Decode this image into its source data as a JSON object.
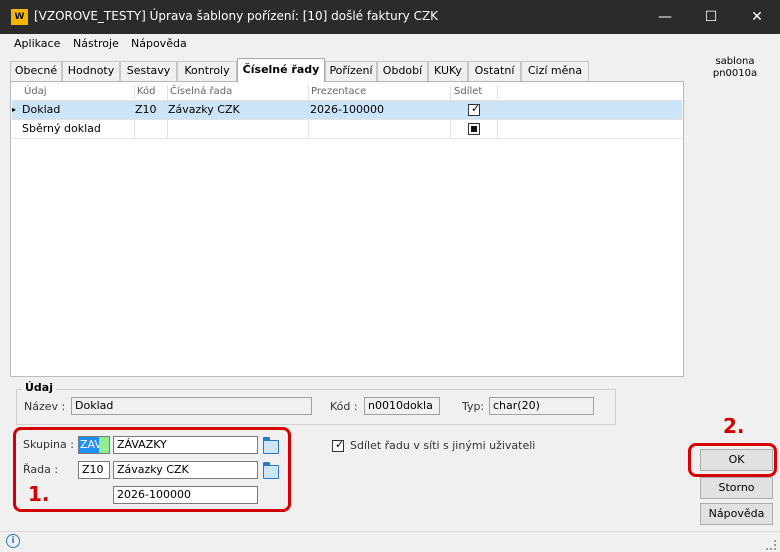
{
  "window": {
    "title": "[VZOROVE_TESTY] Úprava šablony pořízení: [10] došlé faktury CZK",
    "app_icon_text": "W",
    "minimize": "—",
    "maximize": "☐",
    "close": "✕"
  },
  "menu": [
    "Aplikace",
    "Nástroje",
    "Nápověda"
  ],
  "side_label": [
    "sablona",
    "pn0010a"
  ],
  "tabs": [
    {
      "label": "Obecné"
    },
    {
      "label": "Hodnoty"
    },
    {
      "label": "Sestavy"
    },
    {
      "label": "Kontroly"
    },
    {
      "label": "Číselné řady",
      "active": true
    },
    {
      "label": "Pořízení"
    },
    {
      "label": "Období"
    },
    {
      "label": "KUKy"
    },
    {
      "label": "Ostatní"
    },
    {
      "label": "Cizí měna"
    }
  ],
  "grid": {
    "columns": [
      "Údaj",
      "Kód",
      "Číselná řada",
      "Prezentace",
      "Sdílet"
    ],
    "rows": [
      {
        "marker": "▸",
        "udaj": "Doklad",
        "kod": "Z10",
        "rada": "Závazky CZK",
        "prezentace": "2026-100000",
        "sdilet": "checked",
        "selected": true
      },
      {
        "marker": "",
        "udaj": "Sběrný doklad",
        "kod": "",
        "rada": "",
        "prezentace": "",
        "sdilet": "indeterminate",
        "selected": false
      }
    ]
  },
  "udaj_group": {
    "title": "Údaj",
    "nazev_label": "Název :",
    "nazev_value": "Doklad",
    "kod_label": "Kód :",
    "kod_value": "n0010dokla",
    "typ_label": "Typ:",
    "typ_value": "char(20)"
  },
  "skupina": {
    "label": "Skupina :",
    "code": "ZAV",
    "name": "ZÁVAZKY"
  },
  "rada": {
    "label": "Řada :",
    "code": "Z10",
    "name": "Závazky CZK",
    "presentation": "2026-100000"
  },
  "share_checkbox": {
    "label": "Sdílet řadu v síti s jinými uživateli",
    "checked": true
  },
  "buttons": {
    "ok": "OK",
    "storno": "Storno",
    "napoveda": "Nápověda"
  },
  "annotations": {
    "one": "1.",
    "two": "2."
  },
  "colors": {
    "title_bg": "#2b2b2b",
    "selection": "#cce4f7",
    "annotation": "#d40000",
    "code_highlight": "#1e90ff",
    "code_green": "#90ee90"
  },
  "status": {
    "icon": "i"
  }
}
